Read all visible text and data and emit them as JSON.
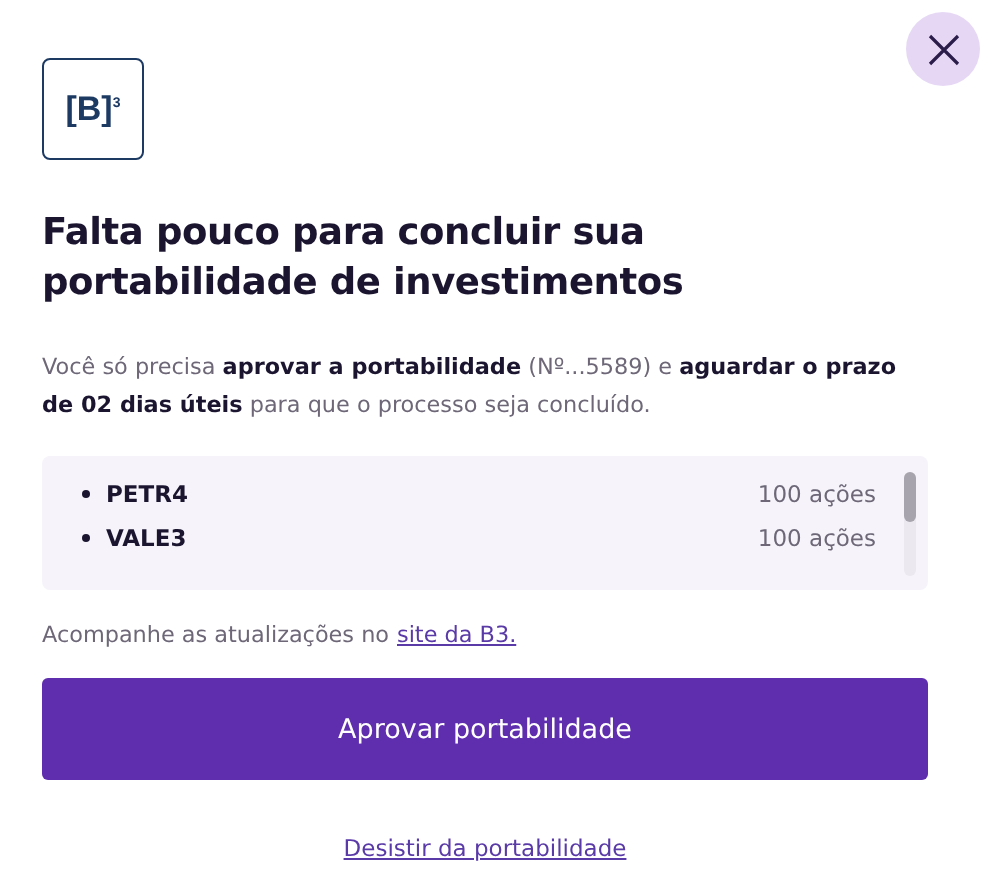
{
  "logo": {
    "text": "[B]",
    "superscript": "3"
  },
  "title": "Falta pouco para concluir sua portabilidade de investimentos",
  "description": "Você só precisa **aprovar a portabilidade** (Nº...5589) e **aguardar o prazo de 02 dias úteis** para que o processo seja concluído.",
  "assets": [
    {
      "ticker": "PETR4",
      "quantity": "100 ações"
    },
    {
      "ticker": "VALE3",
      "quantity": "100 ações"
    }
  ],
  "updates": {
    "text": "Acompanhe as atualizações no",
    "link": "site da B3."
  },
  "primary_button": "Aprovar portabilidade",
  "cancel_link": "Desistir da portabilidade"
}
